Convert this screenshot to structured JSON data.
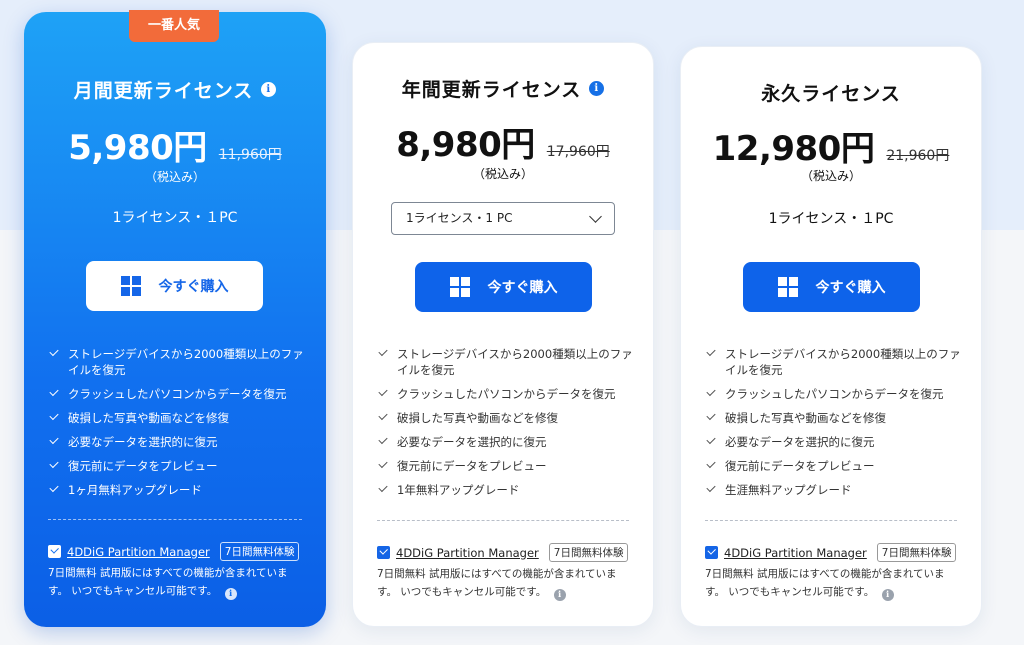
{
  "cards": [
    {
      "badge": "一番人気",
      "title": "月間更新ライセンス",
      "has_info": true,
      "price": "5,980円",
      "old_price": "11,960円",
      "tax": "（税込み）",
      "license": "1ライセンス・１PC",
      "buy_label": "今すぐ購入",
      "features": [
        "ストレージデバイスから2000種類以上のファイルを復元",
        "クラッシュしたパソコンからデータを復元",
        "破損した写真や動画などを修復",
        "必要なデータを選択的に復元",
        "復元前にデータをプレビュー",
        "1ヶ月無料アップグレード"
      ],
      "addon_name": "4DDiG Partition Manager",
      "trial_tag": "7日間無料体験",
      "note": "7日間無料 試用版にはすべての機能が含まれています。 いつでもキャンセル可能です。",
      "note_info": "i"
    },
    {
      "title": "年間更新ライセンス",
      "has_info": true,
      "price": "8,980円",
      "old_price": "17,960円",
      "tax": "（税込み）",
      "license_select": "1ライセンス・1 PC",
      "buy_label": "今すぐ購入",
      "features": [
        "ストレージデバイスから2000種類以上のファイルを復元",
        "クラッシュしたパソコンからデータを復元",
        "破損した写真や動画などを修復",
        "必要なデータを選択的に復元",
        "復元前にデータをプレビュー",
        "1年無料アップグレード"
      ],
      "addon_name": "4DDiG Partition Manager",
      "trial_tag": "7日間無料体験",
      "note": "7日間無料 試用版にはすべての機能が含まれています。 いつでもキャンセル可能です。",
      "note_info": "i"
    },
    {
      "title": "永久ライセンス",
      "has_info": false,
      "price": "12,980円",
      "old_price": "21,960円",
      "tax": "（税込み）",
      "license": "1ライセンス・１PC",
      "buy_label": "今すぐ購入",
      "features": [
        "ストレージデバイスから2000種類以上のファイルを復元",
        "クラッシュしたパソコンからデータを復元",
        "破損した写真や動画などを修復",
        "必要なデータを選択的に復元",
        "復元前にデータをプレビュー",
        "生涯無料アップグレード"
      ],
      "addon_name": "4DDiG Partition Manager",
      "trial_tag": "7日間無料体験",
      "note": "7日間無料 試用版にはすべての機能が含まれています。 いつでもキャンセル可能です。",
      "note_info": "i"
    }
  ],
  "info_glyph": "i",
  "icons": {
    "windows": "windows-icon",
    "info": "info-icon",
    "check": "check-icon",
    "chevron": "chevron-down-icon"
  },
  "colors": {
    "accent": "#0e63ea",
    "badge": "#f26b3a",
    "featured_top": "#1ea2f6",
    "featured_bottom": "#0b5fe6"
  }
}
